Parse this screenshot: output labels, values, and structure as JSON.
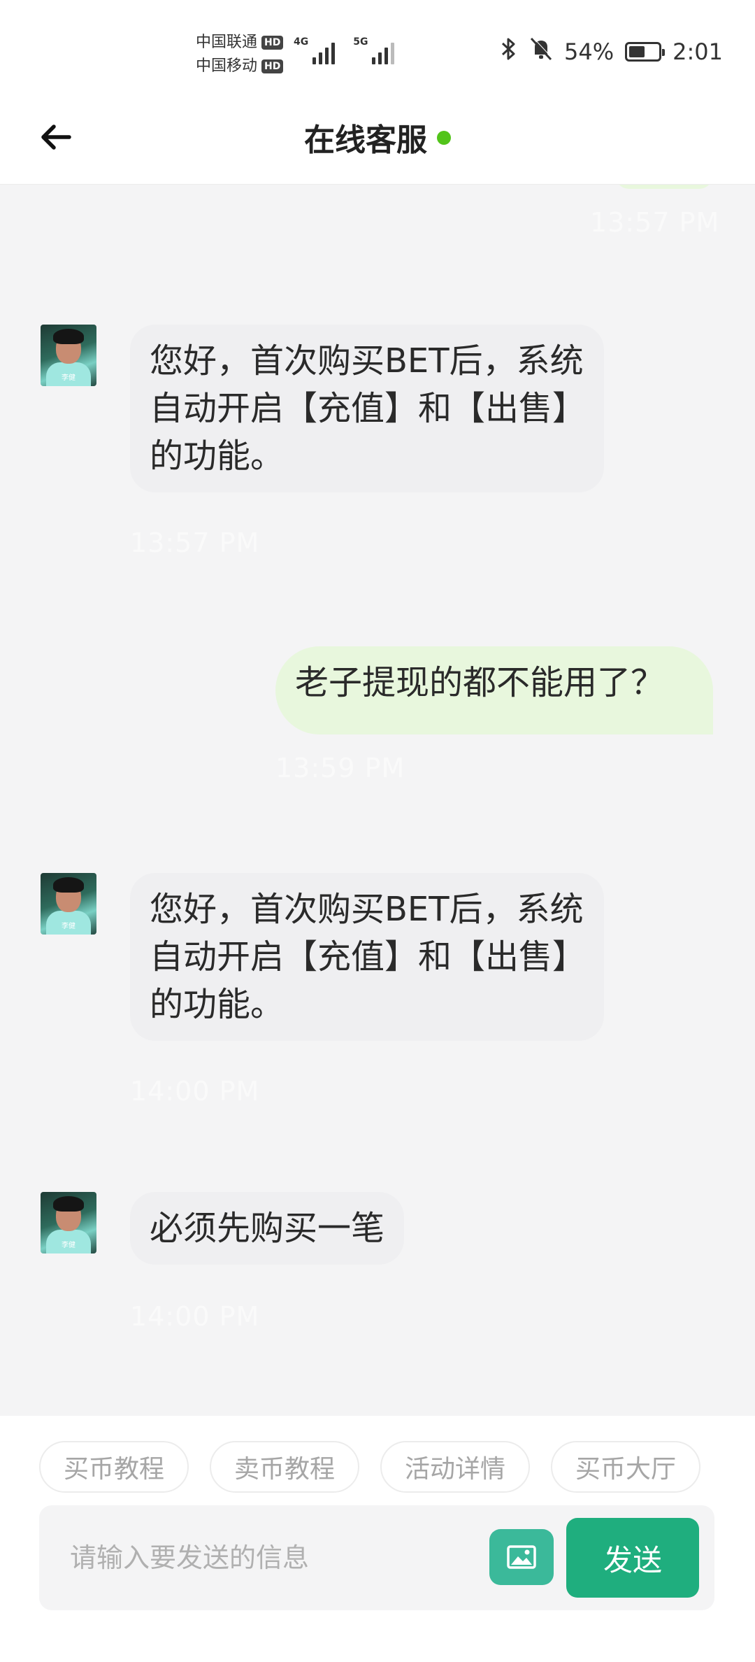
{
  "status_bar": {
    "carrier_1": "中国联通",
    "carrier_2": "中国移动",
    "hd_badge": "HD",
    "network_1": "4G",
    "network_2": "5G",
    "battery_text": "54%",
    "battery_level": 0.54,
    "time": "2:01"
  },
  "header": {
    "title": "在线客服",
    "online_color": "#52c41a"
  },
  "messages": [
    {
      "side": "out",
      "text": "",
      "time": "13:57 PM"
    },
    {
      "side": "in",
      "text": "您好，首次购买BET后，系统自动开启【充值】和【出售】的功能。",
      "time": "13:57 PM"
    },
    {
      "side": "out",
      "text": "老子提现的都不能用了？",
      "time": "13:59 PM"
    },
    {
      "side": "in",
      "text": "您好，首次购买BET后，系统自动开启【充值】和【出售】的功能。",
      "time": "14:00 PM"
    },
    {
      "side": "in",
      "text": "必须先购买一笔",
      "time": "14:00 PM"
    }
  ],
  "avatar_caption": "李健",
  "quick_replies": [
    "买币教程",
    "卖币教程",
    "活动详情",
    "买币大厅"
  ],
  "composer": {
    "placeholder": "请输入要发送的信息",
    "send_label": "发送"
  },
  "colors": {
    "accent": "#1fae7e",
    "image_button": "#3bb99a",
    "outgoing_bubble": "#e8f7dd",
    "incoming_bubble": "#efeff1"
  }
}
